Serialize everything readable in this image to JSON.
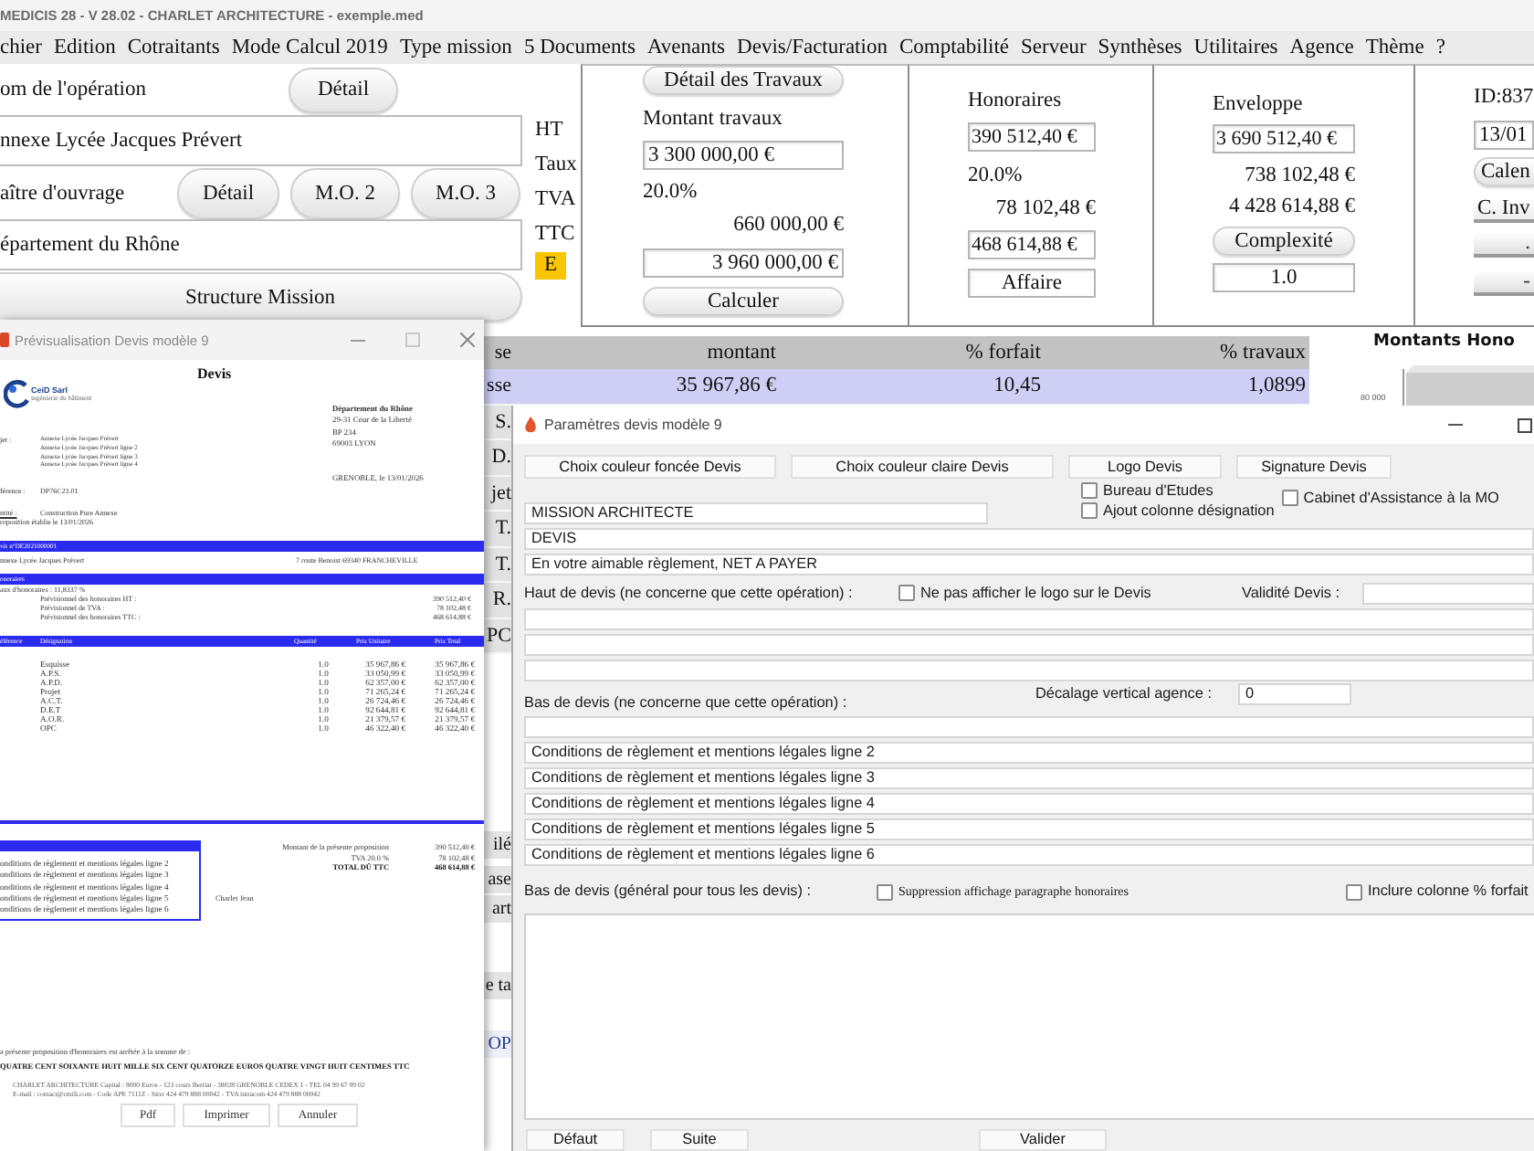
{
  "app_window": {
    "title": "MEDICIS 28 - V 28.02 - CHARLET ARCHITECTURE - exemple.med"
  },
  "menu": [
    "chier",
    "Edition",
    "Cotraitants",
    "Mode Calcul 2019",
    "Type mission",
    "5 Documents",
    "Avenants",
    "Devis/Facturation",
    "Comptabilité",
    "Serveur",
    "Synthèses",
    "Utilitaires",
    "Agence",
    "Thème",
    "?"
  ],
  "operation": {
    "label": "om de l'opération",
    "detail_button": "Détail",
    "value": "nnexe Lycée Jacques Prévert"
  },
  "owner": {
    "label": "aître d'ouvrage",
    "buttons": [
      "Détail",
      "M.O. 2",
      "M.O. 3"
    ],
    "value": "épartement du Rhône"
  },
  "structure_button": "Structure Mission",
  "amount_labels": [
    "HT",
    "Taux",
    "TVA",
    "TTC"
  ],
  "estimate_badge": "E",
  "works": {
    "detail_button": "Détail des Travaux",
    "label": "Montant travaux",
    "amount_ht": "3 300 000,00 €",
    "rate": "20.0%",
    "tva": "660 000,00 €",
    "amount_ttc": "3 960 000,00 €",
    "calculate_button": "Calculer"
  },
  "fees": {
    "title": "Honoraires",
    "amount_ht": "390 512,40 €",
    "rate": "20.0%",
    "tva": "78 102,48 €",
    "amount_ttc": "468 614,88 €",
    "project_field": "Affaire"
  },
  "envelope": {
    "title": "Enveloppe",
    "amount_ht": "3 690 512,40 €",
    "tva": "738 102,48 €",
    "amount_ttc": "4 428 614,88 €",
    "complexity_button": "Complexité",
    "complexity": "1.0"
  },
  "id_panel": {
    "id": "ID:837",
    "date": "13/01",
    "button": "Calen",
    "field": "C. Inv",
    "small_buttons": [
      ".",
      "-"
    ]
  },
  "phase_table": {
    "columns": [
      "se",
      "montant",
      "% forfait",
      "% travaux"
    ],
    "rows": [
      {
        "cells": [
          "sse",
          "35 967,86 €",
          "10,45",
          "1,0899"
        ],
        "selected": true
      },
      {
        "cells": [
          "S."
        ],
        "selected": false
      },
      {
        "cells": [
          "D."
        ],
        "selected": false
      },
      {
        "cells": [
          "jet"
        ],
        "selected": false
      },
      {
        "cells": [
          "T."
        ],
        "selected": false
      },
      {
        "cells": [
          "T."
        ],
        "selected": false
      },
      {
        "cells": [
          "R."
        ],
        "selected": false
      },
      {
        "cells": [
          "PC"
        ],
        "selected": false
      }
    ]
  },
  "side_fragments": [
    "ilé",
    "ase",
    "art",
    "e ta",
    "OP"
  ],
  "chart": {
    "title": "Montants Hono",
    "tick": "80 000"
  },
  "preview_window": {
    "title": "Prévisualisation Devis modèle 9",
    "document": {
      "heading": "Devis",
      "logo_name": "CeiD Sarl",
      "logo_tagline": "ingénierie du bâtiment",
      "object_label": "jet :",
      "object_lines": [
        "Annexe Lycée Jacques Prévert",
        "Annexe Lycée Jacques Prévert ligne 2",
        "Annexe Lycée Jacques Prévert ligne 3",
        "Annexe Lycée Jacques Prévert ligne 4"
      ],
      "reference": {
        "label": "férence :",
        "value": "DP76C23.01"
      },
      "entity": {
        "label": "ntité :",
        "value": "Construction Pure Annexe"
      },
      "established": "roposition établie le 13/01/2026",
      "recipient": {
        "name": "Département du Rhône",
        "lines": [
          "29-31 Cour de la Liberté",
          "BP 234",
          "69003 LYON"
        ]
      },
      "place_date": "GRENOBLE, le 13/01/2026",
      "quote_band": "vis n°DE2021000001",
      "site": {
        "name": "nnexe Lycée Jacques Prévert",
        "address": "7 route Benoist 69340 FRANCHEVILLE"
      },
      "fees_band": "onoraires",
      "fee_rate": "aux d'honoraires : 11,8337 %",
      "fee_lines": [
        {
          "label": "Prévisionnel des honoraires HT :",
          "value": "390 512,40 €"
        },
        {
          "label": "Prévisionnel de TVA :",
          "value": "78 102,48 €"
        },
        {
          "label": "Prévisionnel des honoraires TTC :",
          "value": "468 614,88 €"
        }
      ],
      "columns": [
        "éférence",
        "Désignation",
        "Quantité",
        "Prix Unitaire",
        "Prix Total"
      ],
      "items": [
        {
          "designation": "Esquisse",
          "quantity": "1.0",
          "unit_price": "35 967,86 €",
          "total": "35 967,86 €"
        },
        {
          "designation": "A.P.S.",
          "quantity": "1.0",
          "unit_price": "33 050,99 €",
          "total": "33 050,99 €"
        },
        {
          "designation": "A.P.D.",
          "quantity": "1.0",
          "unit_price": "62 357,00 €",
          "total": "62 357,00 €"
        },
        {
          "designation": "Projet",
          "quantity": "1.0",
          "unit_price": "71 265,24 €",
          "total": "71 265,24 €"
        },
        {
          "designation": "A.C.T.",
          "quantity": "1.0",
          "unit_price": "26 724,46 €",
          "total": "26 724,46 €"
        },
        {
          "designation": "D.E.T",
          "quantity": "1.0",
          "unit_price": "92 644,81 €",
          "total": "92 644,81 €"
        },
        {
          "designation": "A.O.R.",
          "quantity": "1.0",
          "unit_price": "21 379,57 €",
          "total": "21 379,57 €"
        },
        {
          "designation": "OPC",
          "quantity": "1.0",
          "unit_price": "46 322,40 €",
          "total": "46 322,40 €"
        }
      ],
      "conditions": [
        "onditions de règlement et mentions légales ligne 2",
        "onditions de règlement et mentions légales ligne 3",
        "onditions de règlement et mentions légales ligne 4",
        "onditions de règlement et mentions légales ligne 5",
        "onditions de règlement et mentions légales ligne 6"
      ],
      "totals": [
        {
          "label": "Montant de la présente proposition",
          "value": "390 512,40 €",
          "bold": false
        },
        {
          "label": "TVA 20.0 %",
          "value": "78 102,48 €",
          "bold": false
        },
        {
          "label": "TOTAL DÛ TTC",
          "value": "468 614,88 €",
          "bold": true
        }
      ],
      "signatory": "Charlet Jean",
      "amount_intro": "a présente proposition d'honoraires est arrêtée à la somme de :",
      "amount_words": "QUATRE CENT SOIXANTE HUIT MILLE SIX CENT QUATORZE EUROS QUATRE VINGT HUIT CENTIMES TTC",
      "footer": [
        "CHARLET ARCHITECTURE Capital : 8000 Euros - 123 cours Berriat - 38028 GRENOBLE CEDEX 1 - TEL 04 99 67 99 02",
        "E-mail : contact@cmili.com - Code APE 7111Z - Siret 424 479 888 00042 - TVA intracom 424 479 888 00042"
      ]
    },
    "buttons": [
      "Pdf",
      "Imprimer",
      "Annuler"
    ]
  },
  "dialog": {
    "title": "Paramètres devis modèle 9",
    "top_buttons": [
      "Choix couleur foncée Devis",
      "Choix couleur claire Devis",
      "Logo Devis",
      "Signature Devis"
    ],
    "mission_field": "MISSION ARCHITECTE",
    "options": [
      {
        "label": "Bureau d'Etudes",
        "checked": false
      },
      {
        "label": "Ajout colonne désignation",
        "checked": false
      }
    ],
    "assistance_option": {
      "label": "Cabinet d'Assistance à la MO",
      "checked": false
    },
    "title_field": "DEVIS",
    "payment_field": "En votre aimable règlement, NET A PAYER",
    "header_label": "Haut de devis (ne concerne que cette opération) :",
    "hide_logo_option": {
      "label": "Ne pas afficher le logo sur le Devis",
      "checked": false
    },
    "validity_label": "Validité Devis :",
    "offset_label": "Décalage vertical agence :",
    "offset_value": "0",
    "footer_label": "Bas de devis  (ne concerne que cette opération) :",
    "footer_lines": [
      "Conditions de règlement et mentions légales ligne 2",
      "Conditions de règlement et mentions légales ligne 3",
      "Conditions de règlement et mentions légales ligne 4",
      "Conditions de règlement et mentions légales ligne 5",
      "Conditions de règlement et mentions légales ligne 6"
    ],
    "general_label": "Bas de devis  (général pour tous les devis) :",
    "hide_fees_option": {
      "label": "Suppression affichage paragraphe honoraires",
      "checked": false
    },
    "percent_column_option": {
      "label": "Inclure colonne % forfait",
      "checked": false
    },
    "bottom_buttons": [
      "Défaut",
      "Suite",
      "Valider"
    ]
  }
}
